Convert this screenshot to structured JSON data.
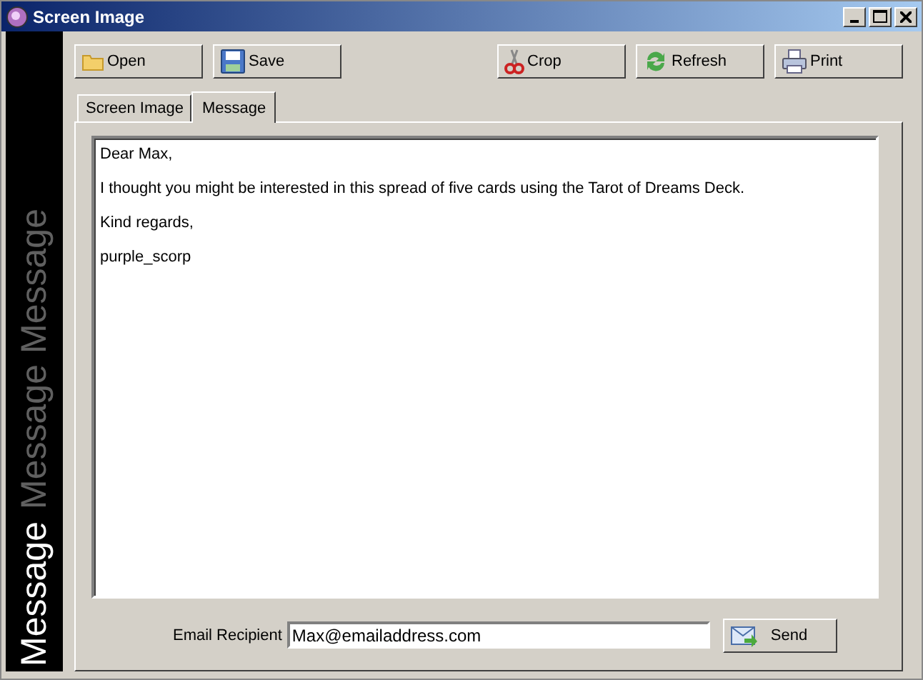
{
  "window": {
    "title": "Screen Image"
  },
  "banner": [
    {
      "text": "Message",
      "highlighted": true
    },
    {
      "text": "Message",
      "highlighted": false
    },
    {
      "text": "Message",
      "highlighted": false
    }
  ],
  "toolbar": [
    {
      "label": "Open",
      "kind": "open"
    },
    {
      "label": "Save",
      "kind": "save"
    },
    {
      "label": "Crop",
      "kind": "crop"
    },
    {
      "label": "Refresh",
      "kind": "refresh"
    },
    {
      "label": "Print",
      "kind": "print"
    }
  ],
  "tabs": [
    {
      "label": "Screen Image",
      "selected": false
    },
    {
      "label": "Message",
      "selected": true
    }
  ],
  "message": [
    "Dear Max,",
    "I thought you might be interested in this spread of five cards using the Tarot of Dreams Deck.",
    "Kind regards,",
    "purple_scorp"
  ],
  "recipient": {
    "label": "Email Recipient",
    "value": "Max@emailaddress.com"
  },
  "send": {
    "label": "Send"
  }
}
